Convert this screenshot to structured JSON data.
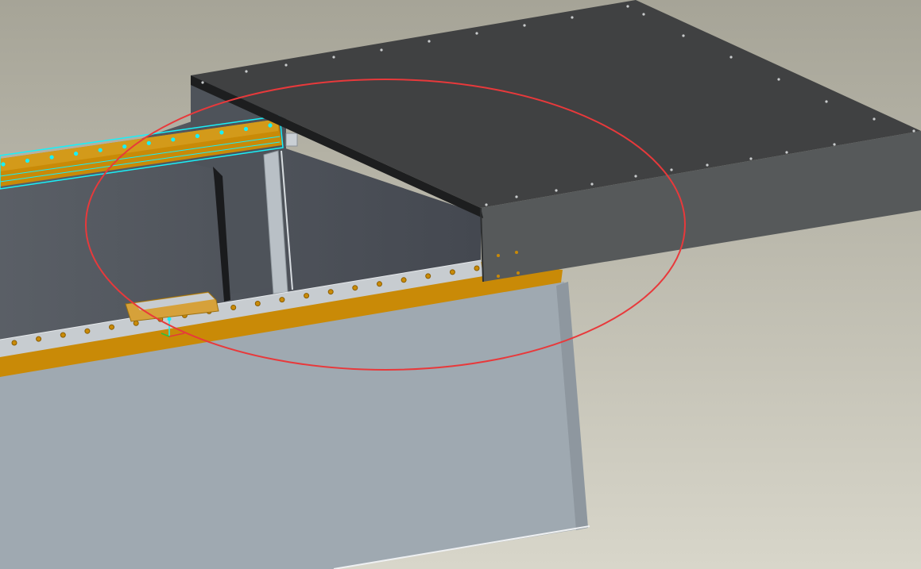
{
  "viewport": {
    "background_top": "#a6a497",
    "background_bottom": "#d8d6ca"
  },
  "model": {
    "top_plate_color": "#404142",
    "top_plate_side_color": "#56595a",
    "cabinet_inner_color": "#484c54",
    "front_panel_color": "#9fa9b1",
    "rail_color": "#c98a07",
    "rail_face_color": "#c7ccd0",
    "selection_color": "#19f0f8"
  },
  "markup": {
    "highlight_ellipse_color": "#e8393b"
  }
}
